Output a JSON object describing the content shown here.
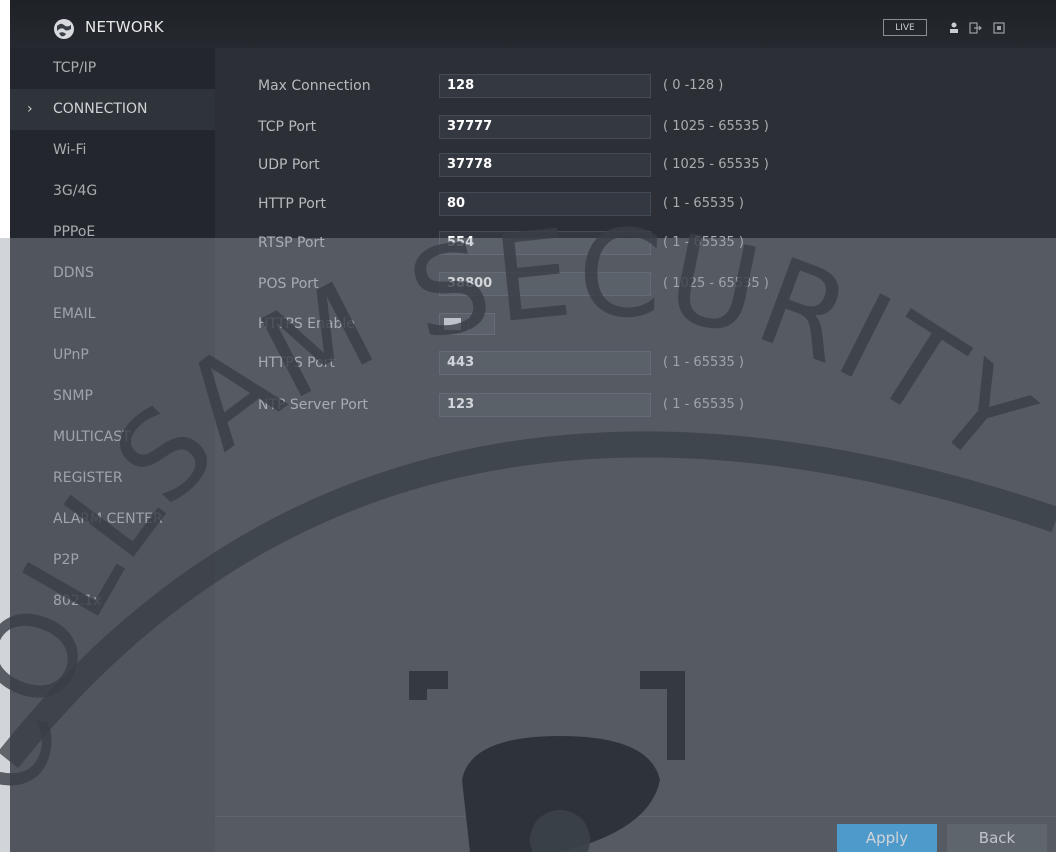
{
  "header": {
    "title": "NETWORK",
    "live_label": "LIVE"
  },
  "sidebar": {
    "items": [
      {
        "label": "TCP/IP"
      },
      {
        "label": "CONNECTION",
        "active": true
      },
      {
        "label": "Wi-Fi"
      },
      {
        "label": "3G/4G"
      },
      {
        "label": "PPPoE"
      },
      {
        "label": "DDNS"
      },
      {
        "label": "EMAIL"
      },
      {
        "label": "UPnP"
      },
      {
        "label": "SNMP"
      },
      {
        "label": "MULTICAST"
      },
      {
        "label": "REGISTER"
      },
      {
        "label": "ALARM CENTER"
      },
      {
        "label": "P2P"
      },
      {
        "label": "802.1x"
      }
    ]
  },
  "connection": {
    "max_connection": {
      "label": "Max Connection",
      "value": "128",
      "range": "( 0 -128 )"
    },
    "tcp_port": {
      "label": "TCP Port",
      "value": "37777",
      "range": "( 1025 - 65535 )"
    },
    "udp_port": {
      "label": "UDP Port",
      "value": "37778",
      "range": "( 1025 - 65535 )"
    },
    "http_port": {
      "label": "HTTP Port",
      "value": "80",
      "range": "( 1 - 65535 )"
    },
    "rtsp_port": {
      "label": "RTSP Port",
      "value": "554",
      "range": "( 1 - 65535 )"
    },
    "pos_port": {
      "label": "POS Port",
      "value": "38800",
      "range": "( 1025 - 65535 )"
    },
    "https_enable": {
      "label": "HTTPS Enable",
      "enabled": false
    },
    "https_port": {
      "label": "HTTPS Port",
      "value": "443",
      "range": "( 1 - 65535 )"
    },
    "ntp_server_port": {
      "label": "NTP Server Port",
      "value": "123",
      "range": "( 1 - 65535 )"
    }
  },
  "buttons": {
    "apply": "Apply",
    "back": "Back"
  },
  "watermark": {
    "text": "COLLSAM SECURITY"
  },
  "colors": {
    "accent": "#1e9be8",
    "panel": "#2c3036",
    "sidebar": "#23272d"
  }
}
